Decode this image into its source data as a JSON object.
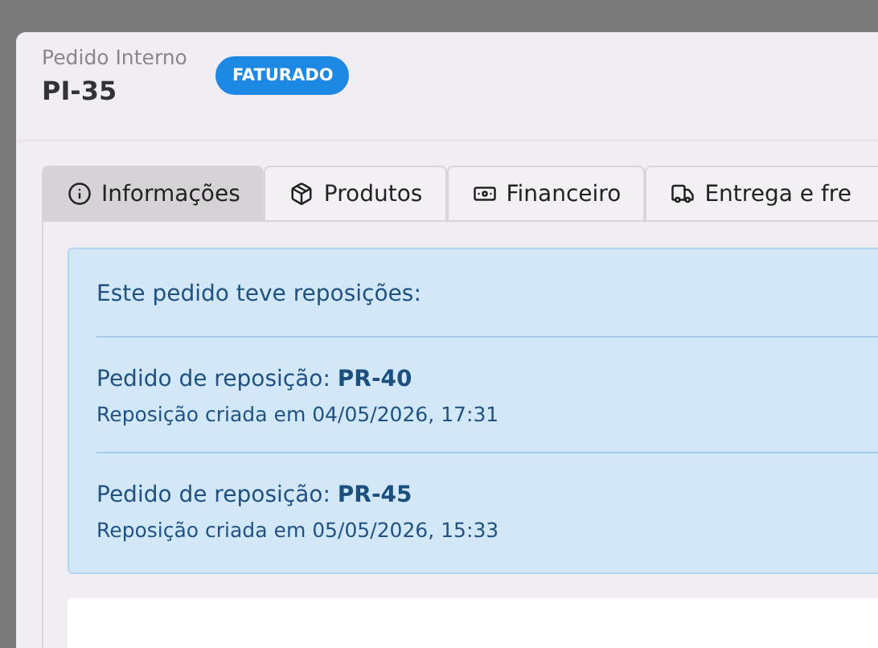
{
  "header": {
    "label": "Pedido Interno",
    "code": "PI-35",
    "status": "FATURADO"
  },
  "tabs": [
    {
      "label": "Informações",
      "kind": "info",
      "selected": true
    },
    {
      "label": "Produtos",
      "kind": "products",
      "selected": false
    },
    {
      "label": "Financeiro",
      "kind": "finance",
      "selected": false
    },
    {
      "label": "Entrega e fre",
      "kind": "delivery",
      "selected": false
    }
  ],
  "alert": {
    "title": "Este pedido teve reposições:",
    "items": [
      {
        "order": "Pedido de reposição: **PR-40**",
        "created": "Reposição criada em 04/05/2026, 17:31"
      },
      {
        "order": "Pedido de reposição: **PR-45**",
        "created": "Reposição criada em 05/05/2026, 15:33"
      }
    ]
  }
}
